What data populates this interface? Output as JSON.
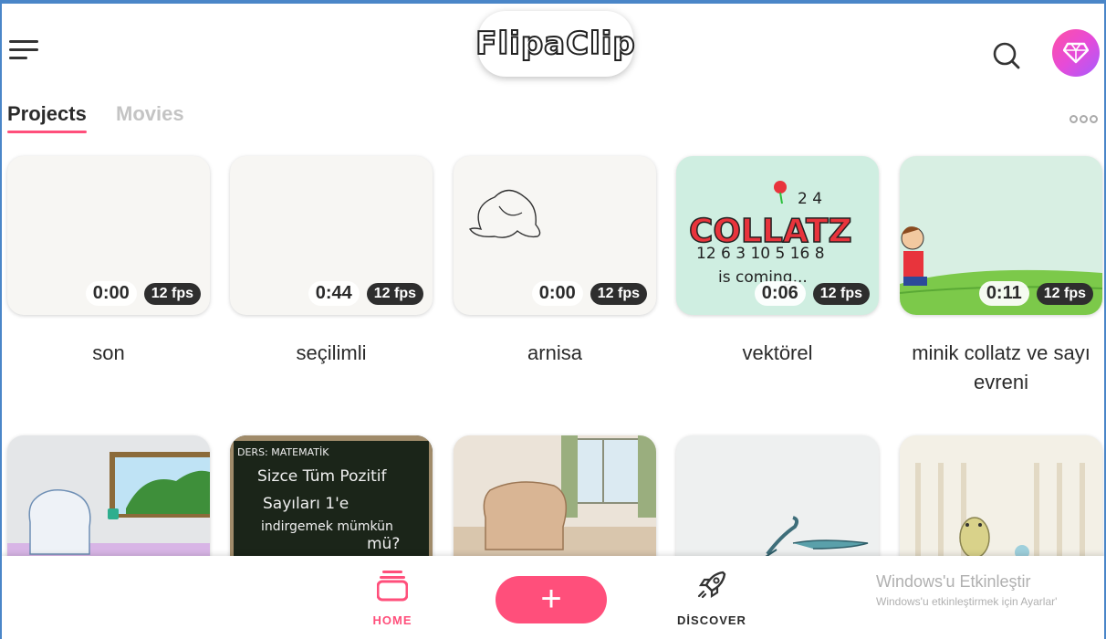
{
  "header": {
    "logo_text": "FlipaClip",
    "menu_icon": "hamburger-menu-icon",
    "search_icon": "search-icon",
    "premium_icon": "diamond-icon"
  },
  "tabs": [
    {
      "label": "Projects",
      "active": true
    },
    {
      "label": "Movies",
      "active": false
    }
  ],
  "projects_row1": [
    {
      "title": "son",
      "duration": "0:00",
      "fps": "12 fps"
    },
    {
      "title": "seçilimli",
      "duration": "0:44",
      "fps": "12 fps"
    },
    {
      "title": "arnisa",
      "duration": "0:00",
      "fps": "12 fps"
    },
    {
      "title": "vektörel",
      "duration": "0:06",
      "fps": "12 fps",
      "thumb_text": {
        "big": "COLLATZ",
        "nums": "12 6 3 10 5 16 8",
        "top_nums": "2 4",
        "line": "is coming..."
      }
    },
    {
      "title": "minik collatz ve sayı evreni",
      "duration": "0:11",
      "fps": "12 fps"
    }
  ],
  "projects_row2": [
    {
      "thumb": "room-with-window"
    },
    {
      "thumb": "chalkboard",
      "board_text": {
        "header": "DERS: MATEMATİK",
        "line1": "Sizce Tüm Pozitif",
        "line2": "Sayıları 1'e",
        "line3": "indirgemek mümkün",
        "line4": "mü?"
      }
    },
    {
      "thumb": "armchair-room"
    },
    {
      "thumb": "lizard"
    },
    {
      "thumb": "garden"
    }
  ],
  "bottom_nav": {
    "home_label": "HOME",
    "add_label": "+",
    "discover_label": "DİSCOVER"
  },
  "activation": {
    "title": "Windows'u Etkinleştir",
    "subtitle": "Windows'u etkinleştirmek için Ayarlar'"
  },
  "colors": {
    "accent": "#ff4f7b",
    "window_border": "#4a86c8",
    "fps_badge": "#2e2e2e"
  }
}
